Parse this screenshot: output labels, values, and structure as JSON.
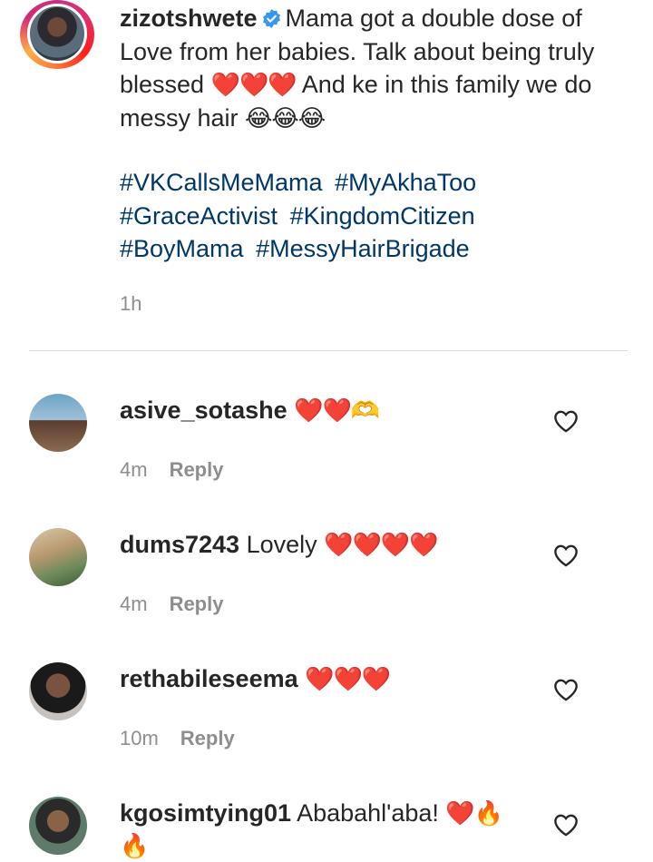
{
  "post": {
    "username": "zizotshwete",
    "verified_icon": "verified-badge-icon",
    "caption_line1": "Mama got a double dose of Love from her babies. Talk about being truly blessed",
    "caption_emojis1": "❤️❤️❤️",
    "caption_line2": "And ke in this family we do messy hair",
    "caption_emojis2": "😂😂😂",
    "hashtags": [
      "#VKCallsMeMama",
      "#MyAkhaToo",
      "#GraceActivist",
      "#KingdomCitizen",
      "#BoyMama",
      "#MessyHairBrigade"
    ],
    "time": "1h"
  },
  "comments": [
    {
      "username": "asive_sotashe",
      "text": "",
      "emojis": "❤️❤️🫶",
      "time": "4m",
      "reply_label": "Reply"
    },
    {
      "username": "dums7243",
      "text": "Lovely",
      "emojis": "❤️❤️❤️❤️",
      "time": "4m",
      "reply_label": "Reply"
    },
    {
      "username": "rethabileseema",
      "text": "",
      "emojis": "❤️❤️❤️",
      "time": "10m",
      "reply_label": "Reply"
    },
    {
      "username": "kgosimtying01",
      "text": "Ababahl'aba!",
      "emojis": "❤️🔥🔥",
      "time": "",
      "reply_label": ""
    }
  ],
  "colors": {
    "link": "#00376b",
    "muted": "#8e8e8e",
    "verified": "#3897f0"
  }
}
